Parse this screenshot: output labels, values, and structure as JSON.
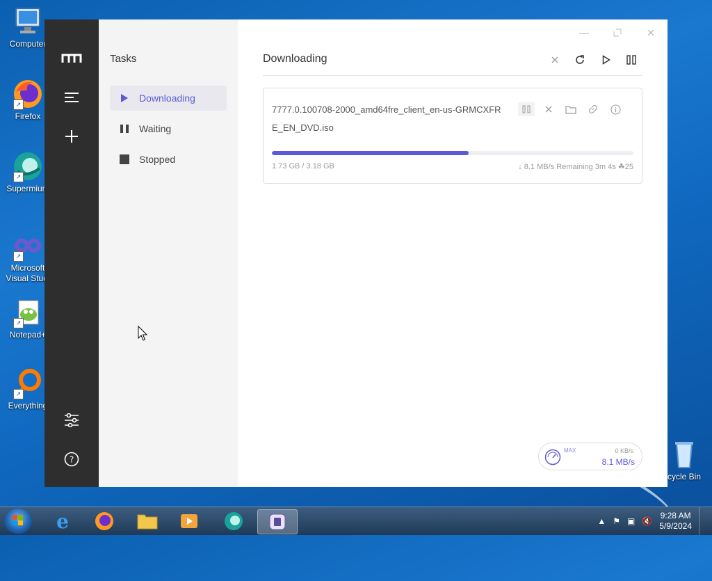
{
  "desktop": {
    "icons": [
      {
        "label": "Computer"
      },
      {
        "label": "Firefox"
      },
      {
        "label": "Supermium"
      },
      {
        "label": "Microsoft Visual Studi"
      },
      {
        "label": "Notepad+"
      },
      {
        "label": "Everything"
      },
      {
        "label": "cycle Bin"
      }
    ]
  },
  "app": {
    "sidebar": {
      "title": "Tasks",
      "items": [
        {
          "label": "Downloading",
          "icon": "play-icon"
        },
        {
          "label": "Waiting",
          "icon": "pause-icon"
        },
        {
          "label": "Stopped",
          "icon": "stop-icon"
        }
      ]
    },
    "main": {
      "title": "Downloading"
    },
    "task": {
      "filename": "7777.0.100708-2000_amd64fre_client_en-us-GRMCXFRE_EN_DVD.iso",
      "size": "1.73 GB / 3.18 GB",
      "progress": 0.544,
      "speed": "8.1 MB/s",
      "remaining": "Remaining 3m 4s",
      "connections": "25"
    },
    "speedometer": {
      "max_label": "MAX",
      "upload": "0 KB/s",
      "download": "8.1 MB/s"
    }
  },
  "taskbar": {
    "time": "9:28 AM",
    "date": "5/9/2024"
  },
  "colors": {
    "accent": "#5b5bd6",
    "rail": "#2e2e2e"
  }
}
